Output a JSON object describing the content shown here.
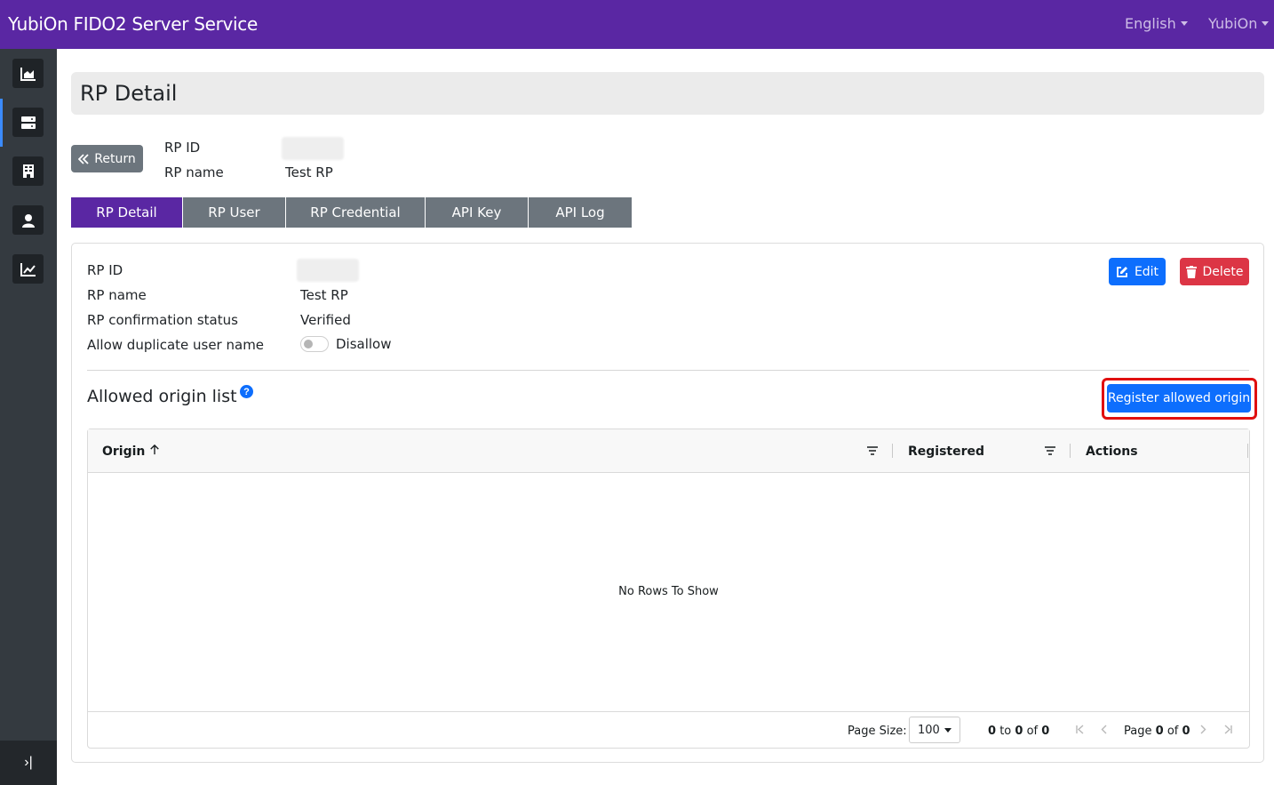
{
  "app": {
    "title": "YubiOn FIDO2 Server Service"
  },
  "topbar": {
    "language": "English",
    "user": "YubiOn"
  },
  "sidebar": {
    "items": [
      {
        "name": "dashboard",
        "icon": "area-chart-icon"
      },
      {
        "name": "servers",
        "icon": "server-icon"
      },
      {
        "name": "organization",
        "icon": "building-icon"
      },
      {
        "name": "users",
        "icon": "user-icon"
      },
      {
        "name": "statistics",
        "icon": "line-chart-icon"
      }
    ],
    "collapse_icon": "›|"
  },
  "page": {
    "title": "RP Detail"
  },
  "header_info": {
    "return_label": "Return",
    "rp_id_label": "RP ID",
    "rp_name_label": "RP name",
    "rp_name_value": "Test RP"
  },
  "tabs": [
    {
      "label": "RP Detail",
      "active": true
    },
    {
      "label": "RP User",
      "active": false
    },
    {
      "label": "RP Credential",
      "active": false
    },
    {
      "label": "API Key",
      "active": false
    },
    {
      "label": "API Log",
      "active": false
    }
  ],
  "detail": {
    "rp_id_label": "RP ID",
    "rp_name_label": "RP name",
    "rp_name_value": "Test RP",
    "confirmation_label": "RP confirmation status",
    "confirmation_value": "Verified",
    "duplicate_label": "Allow duplicate user name",
    "duplicate_value": "Disallow",
    "edit_label": "Edit",
    "delete_label": "Delete"
  },
  "origins": {
    "title": "Allowed origin list",
    "help": "?",
    "register_label": "Register allowed origin",
    "columns": {
      "origin": "Origin",
      "registered": "Registered",
      "actions": "Actions"
    },
    "empty_text": "No Rows To Show"
  },
  "pagination": {
    "page_size_label": "Page Size:",
    "page_size_value": "100",
    "range_from": "0",
    "range_to": "0",
    "range_total": "0",
    "to_word": "to",
    "of_word": "of",
    "page_word": "Page",
    "page_current": "0",
    "page_total": "0"
  },
  "colors": {
    "brand": "#5a27a3",
    "primary": "#0d6efd",
    "danger": "#dc3545",
    "secondary": "#6c757d",
    "highlight": "#e01010"
  }
}
